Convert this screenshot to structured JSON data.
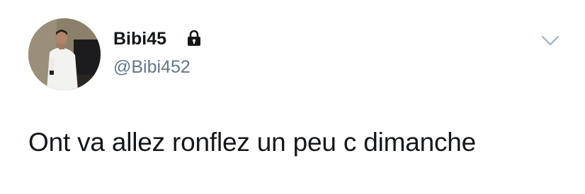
{
  "tweet": {
    "author": {
      "display_name": "Bibi45",
      "handle": "@Bibi452",
      "protected_icon": "lock-icon",
      "avatar": "profile-photo"
    },
    "menu_icon": "chevron-down-icon",
    "text": "Ont va allez ronflez un peu c dimanche"
  },
  "colors": {
    "text_primary": "#14171a",
    "text_secondary": "#657786",
    "chevron": "#aab8c2",
    "background": "#ffffff"
  }
}
